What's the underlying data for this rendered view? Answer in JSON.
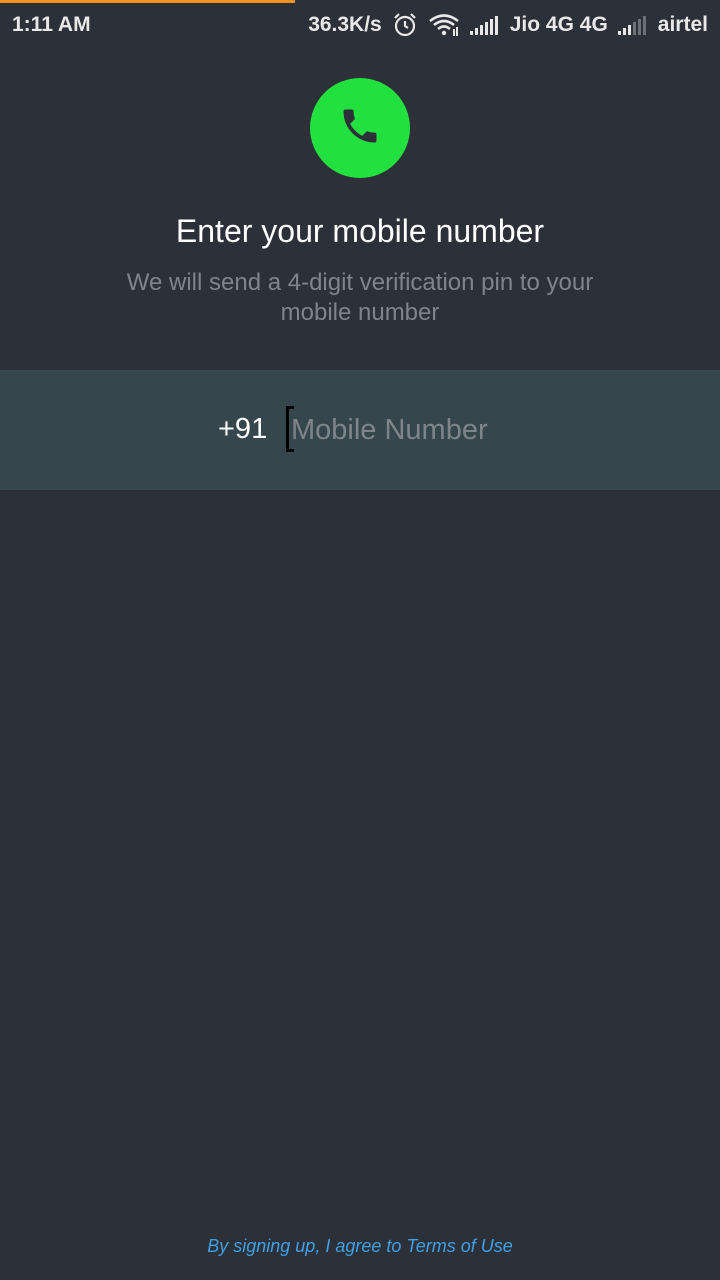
{
  "status_bar": {
    "time": "1:11 AM",
    "speed": "36.3K/s",
    "carrier_1": "Jio 4G 4G",
    "carrier_2": "airtel",
    "icons": [
      "alarm-icon",
      "wifi-icon",
      "signal-icon",
      "signal-weak-icon"
    ]
  },
  "header": {
    "icon": "phone-icon",
    "title": "Enter your mobile number",
    "subtitle": "We will send a 4-digit verification pin to your mobile number"
  },
  "phone_input": {
    "country_code": "+91",
    "placeholder": "Mobile Number",
    "value": ""
  },
  "footer": {
    "terms_text": "By signing up, I agree to Terms of Use"
  },
  "colors": {
    "background": "#2c3038",
    "input_band": "#36464d",
    "accent_green": "#22e03e",
    "link_blue": "#3fa0e8",
    "progress_orange": "#f7931e"
  }
}
